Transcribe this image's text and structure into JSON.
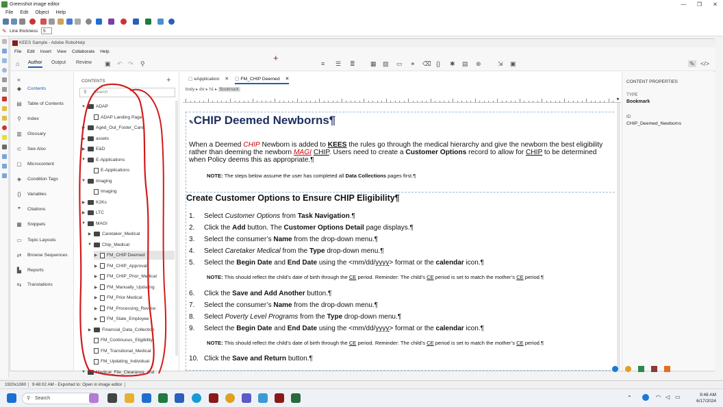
{
  "greenshot": {
    "title": "Greenshot image editor",
    "menu": [
      "File",
      "Edit",
      "Object",
      "Help"
    ],
    "line_thickness_label": "Line thickness",
    "line_thickness_value": "5"
  },
  "robohelp": {
    "title": "KEES Sample - Adobe RoboHelp",
    "menu": [
      "File",
      "Edit",
      "Insert",
      "View",
      "Collaborate",
      "Help"
    ],
    "tabs": {
      "author": "Author",
      "output": "Output",
      "review": "Review"
    },
    "nav": [
      {
        "label": "Contents",
        "icon": "contents-icon",
        "glyph": "◆"
      },
      {
        "label": "Table of Contents",
        "icon": "toc-icon",
        "glyph": "▤"
      },
      {
        "label": "Index",
        "icon": "index-icon",
        "glyph": "⚲"
      },
      {
        "label": "Glossary",
        "icon": "glossary-icon",
        "glyph": "▥"
      },
      {
        "label": "See Also",
        "icon": "see-also-icon",
        "glyph": "⊂"
      },
      {
        "label": "Microcontent",
        "icon": "microcontent-icon",
        "glyph": "▢"
      },
      {
        "label": "Condition Tags",
        "icon": "tag-icon",
        "glyph": "◈"
      },
      {
        "label": "Variables",
        "icon": "variables-icon",
        "glyph": "{}"
      },
      {
        "label": "Citations",
        "icon": "citations-icon",
        "glyph": "❞"
      },
      {
        "label": "Snippets",
        "icon": "snippets-icon",
        "glyph": "▦"
      },
      {
        "label": "Topic Layouts",
        "icon": "layouts-icon",
        "glyph": "▭"
      },
      {
        "label": "Browse Sequences",
        "icon": "sequence-icon",
        "glyph": "⇄"
      },
      {
        "label": "Reports",
        "icon": "reports-icon",
        "glyph": "▙"
      },
      {
        "label": "Translations",
        "icon": "translations-icon",
        "glyph": "⇆"
      }
    ],
    "contents_header": "CONTENTS",
    "search_placeholder": "Search",
    "tree": [
      {
        "label": "ADAP",
        "level": 0,
        "type": "folder",
        "open": true
      },
      {
        "label": "ADAP Landing Page",
        "level": 1,
        "type": "page"
      },
      {
        "label": "Aged_Out_Foster_Care",
        "level": 0,
        "type": "folder"
      },
      {
        "label": "assets",
        "level": 0,
        "type": "folder"
      },
      {
        "label": "E&D",
        "level": 0,
        "type": "folder"
      },
      {
        "label": "E-Applications",
        "level": 0,
        "type": "folder",
        "open": true
      },
      {
        "label": "E-Applications",
        "level": 1,
        "type": "page"
      },
      {
        "label": "Imaging",
        "level": 0,
        "type": "folder",
        "open": true
      },
      {
        "label": "Imaging",
        "level": 1,
        "type": "page"
      },
      {
        "label": "K2Ks",
        "level": 0,
        "type": "folder"
      },
      {
        "label": "LTC",
        "level": 0,
        "type": "folder"
      },
      {
        "label": "MAGI",
        "level": 0,
        "type": "folder",
        "open": true
      },
      {
        "label": "Caretaker_Medical",
        "level": 1,
        "type": "folder"
      },
      {
        "label": "Chip_Medical",
        "level": 1,
        "type": "folder",
        "open": true
      },
      {
        "label": "FM_CHIP Deemed",
        "level": 2,
        "type": "page",
        "selected": true
      },
      {
        "label": "FM_CHIP_Approval",
        "level": 2,
        "type": "page"
      },
      {
        "label": "FM_CHIP_Prior_Medical",
        "level": 2,
        "type": "page"
      },
      {
        "label": "FM_Manually_Updating",
        "level": 2,
        "type": "page"
      },
      {
        "label": "FM_Prior Medical",
        "level": 2,
        "type": "page"
      },
      {
        "label": "FM_Processing_Review",
        "level": 2,
        "type": "page"
      },
      {
        "label": "FM_State_Employee",
        "level": 2,
        "type": "page"
      },
      {
        "label": "Financial_Data_Collection",
        "level": 1,
        "type": "folder"
      },
      {
        "label": "FM_Continuous_Eligibility",
        "level": 1,
        "type": "page"
      },
      {
        "label": "FM_Transitional_Medical",
        "level": 1,
        "type": "page"
      },
      {
        "label": "FM_Updating_Individual",
        "level": 1,
        "type": "page"
      },
      {
        "label": "Medical_File_Clearance_and",
        "level": 0,
        "type": "folder",
        "open": true
      }
    ],
    "editor_tabs": [
      "eApplication",
      "FM_CHIP Deemed"
    ],
    "breadcrumb": [
      "body",
      "div",
      "h1",
      "Bookmark"
    ],
    "properties": {
      "header": "CONTENT PROPERTIES",
      "type_label": "TYPE",
      "type_value": "Bookmark",
      "id_label": "ID",
      "id_value": "CHIP_Deemed_Newborns"
    }
  },
  "doc": {
    "h1": "CHIP Deemed Newborns¶",
    "intro": [
      {
        "t": "When a Deemed "
      },
      {
        "t": "CHIP",
        "c": "red it"
      },
      {
        "t": " Newborn is added to "
      },
      {
        "t": "KEES",
        "c": "b ul"
      },
      {
        "t": " the rules go through the medical hierarchy and give the newborn the best eligibility"
      }
    ],
    "intro2": [
      {
        "t": "rather than deeming the newborn "
      },
      {
        "t": "MAGI",
        "c": "red it ul"
      },
      {
        "t": " "
      },
      {
        "t": "CHIP",
        "c": "ul"
      },
      {
        "t": ". Users need to create a "
      },
      {
        "t": "Customer Options",
        "c": "b"
      },
      {
        "t": " record to allow for "
      },
      {
        "t": "CHIP",
        "c": "ul"
      },
      {
        "t": " to be determined"
      }
    ],
    "intro3": "when Policy deems this as appropriate.¶",
    "note1": [
      {
        "t": "NOTE:",
        "c": "b"
      },
      {
        "t": " The steps below assume the user has completed all "
      },
      {
        "t": "Data Collections",
        "c": "b"
      },
      {
        "t": " pages first.¶"
      }
    ],
    "h2": "Create Customer Options to Ensure CHIP Eligibility¶",
    "steps": [
      {
        "n": "1.",
        "parts": [
          {
            "t": "Select "
          },
          {
            "t": "Customer Options",
            "c": "it"
          },
          {
            "t": " from "
          },
          {
            "t": "Task Navigation",
            "c": "b"
          },
          {
            "t": ".¶"
          }
        ]
      },
      {
        "n": "2.",
        "parts": [
          {
            "t": "Click the "
          },
          {
            "t": "Add",
            "c": "b"
          },
          {
            "t": " button. The "
          },
          {
            "t": "Customer Options Detail",
            "c": "b"
          },
          {
            "t": " page displays.¶"
          }
        ]
      },
      {
        "n": "3.",
        "parts": [
          {
            "t": "Select the consumer’s "
          },
          {
            "t": "Name",
            "c": "b"
          },
          {
            "t": " from the drop-down menu.¶"
          }
        ]
      },
      {
        "n": "4.",
        "parts": [
          {
            "t": "Select "
          },
          {
            "t": "Caretaker Medical",
            "c": "it"
          },
          {
            "t": " from the "
          },
          {
            "t": "Type",
            "c": "b"
          },
          {
            "t": " drop-down menu.¶"
          }
        ]
      },
      {
        "n": "5.",
        "parts": [
          {
            "t": "Select the "
          },
          {
            "t": "Begin Date",
            "c": "b"
          },
          {
            "t": " and "
          },
          {
            "t": "End Date",
            "c": "b"
          },
          {
            "t": " using the <mm/dd/"
          },
          {
            "t": "yyyy",
            "c": "ul"
          },
          {
            "t": "> format or the "
          },
          {
            "t": "calendar",
            "c": "b"
          },
          {
            "t": " icon.¶"
          }
        ]
      },
      {
        "n": "6.",
        "parts": [
          {
            "t": "Click the "
          },
          {
            "t": "Save and Add Another",
            "c": "b"
          },
          {
            "t": " button.¶"
          }
        ]
      },
      {
        "n": "7.",
        "parts": [
          {
            "t": "Select the consumer’s "
          },
          {
            "t": "Name",
            "c": "b"
          },
          {
            "t": " from the drop-down menu.¶"
          }
        ]
      },
      {
        "n": "8.",
        "parts": [
          {
            "t": "Select "
          },
          {
            "t": "Poverty Level Programs",
            "c": "it"
          },
          {
            "t": " from the "
          },
          {
            "t": "Type",
            "c": "b"
          },
          {
            "t": " drop-down menu.¶"
          }
        ]
      },
      {
        "n": "9.",
        "parts": [
          {
            "t": "Select the "
          },
          {
            "t": "Begin Date",
            "c": "b"
          },
          {
            "t": " and "
          },
          {
            "t": "End Date",
            "c": "b"
          },
          {
            "t": " using the <mm/dd/"
          },
          {
            "t": "yyyy",
            "c": "ul"
          },
          {
            "t": "> format or the "
          },
          {
            "t": "calendar",
            "c": "b"
          },
          {
            "t": " icon.¶"
          }
        ]
      },
      {
        "n": "10.",
        "parts": [
          {
            "t": "Click the "
          },
          {
            "t": "Save and Return",
            "c": "b"
          },
          {
            "t": " button.¶"
          }
        ]
      }
    ],
    "note2": [
      {
        "t": "NOTE:",
        "c": "b"
      },
      {
        "t": " This should reflect the child’s date of birth through the "
      },
      {
        "t": "CE",
        "c": "ul"
      },
      {
        "t": " period. Reminder: The child’s "
      },
      {
        "t": "CE",
        "c": "ul"
      },
      {
        "t": " period is set to match the mother’s "
      },
      {
        "t": "CE",
        "c": "ul"
      },
      {
        "t": " period.¶"
      }
    ]
  },
  "status": {
    "size": "1920x1080",
    "message": "9:48:02 AM - Exported to: Open in image editor"
  },
  "taskbar": {
    "search": "Search",
    "time": "9:48 AM",
    "date": "6/17/2024"
  }
}
